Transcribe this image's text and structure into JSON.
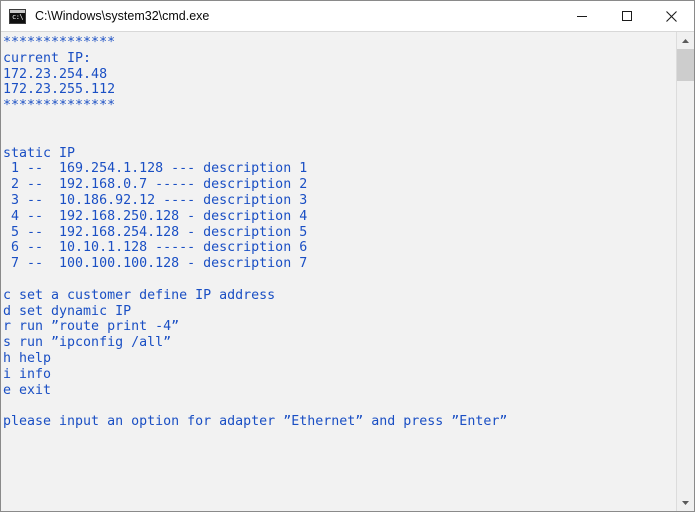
{
  "window": {
    "title": "C:\\Windows\\system32\\cmd.exe",
    "icon": "cmd-console-icon",
    "icon_glyph": "c:\\",
    "background_color": "#f2f2f2",
    "border_color": "#8a8a8a",
    "titlebar_color": "#ffffff"
  },
  "title_buttons": {
    "minimize_label": "Minimize",
    "maximize_label": "Maximize",
    "close_label": "Close"
  },
  "console": {
    "text_color": "#1a4fc4",
    "background_color": "#f2f2f2",
    "banner_top": "**************",
    "banner_bottom": "**************",
    "current_ip_header": "current IP:",
    "current_ips": [
      "172.23.254.48",
      "172.23.255.112"
    ],
    "static_ip_header": "static IP",
    "static_ip_entries": [
      {
        "index": "1",
        "sep": "--",
        "address": "169.254.1.128",
        "dashes": "---",
        "description": "description 1"
      },
      {
        "index": "2",
        "sep": "--",
        "address": "192.168.0.7",
        "dashes": "-----",
        "description": "description 2"
      },
      {
        "index": "3",
        "sep": "--",
        "address": "10.186.92.12",
        "dashes": "----",
        "description": "description 3"
      },
      {
        "index": "4",
        "sep": "--",
        "address": "192.168.250.128",
        "dashes": "-",
        "description": "description 4"
      },
      {
        "index": "5",
        "sep": "--",
        "address": "192.168.254.128",
        "dashes": "-",
        "description": "description 5"
      },
      {
        "index": "6",
        "sep": "--",
        "address": "10.10.1.128",
        "dashes": "-----",
        "description": "description 6"
      },
      {
        "index": "7",
        "sep": "--",
        "address": "100.100.100.128",
        "dashes": "-",
        "description": "description 7"
      }
    ],
    "menu_options": [
      {
        "key": "c",
        "text": "set a customer define IP address"
      },
      {
        "key": "d",
        "text": "set dynamic IP"
      },
      {
        "key": "r",
        "text": "run ”route print -4”"
      },
      {
        "key": "s",
        "text": "run ”ipconfig /all”"
      },
      {
        "key": "h",
        "text": "help"
      },
      {
        "key": "i",
        "text": "info"
      },
      {
        "key": "e",
        "text": "exit"
      }
    ],
    "prompt": "please input an option for adapter ”Ethernet” and press ”Enter”",
    "full_text": "**************\ncurrent IP:\n172.23.254.48\n172.23.255.112\n**************\n\n\nstatic IP\n 1 --  169.254.1.128 --- description 1\n 2 --  192.168.0.7 ----- description 2\n 3 --  10.186.92.12 ---- description 3\n 4 --  192.168.250.128 - description 4\n 5 --  192.168.254.128 - description 5\n 6 --  10.10.1.128 ----- description 6\n 7 --  100.100.100.128 - description 7\n\nc set a customer define IP address\nd set dynamic IP\nr run ”route print -4”\ns run ”ipconfig /all”\nh help\ni info\ne exit\n\nplease input an option for adapter ”Ethernet” and press ”Enter”"
  },
  "scrollbar": {
    "up_arrow": "scroll-up-arrow",
    "down_arrow": "scroll-down-arrow",
    "thumb_color": "#cdcdcd",
    "track_color": "#f0f0f0"
  }
}
